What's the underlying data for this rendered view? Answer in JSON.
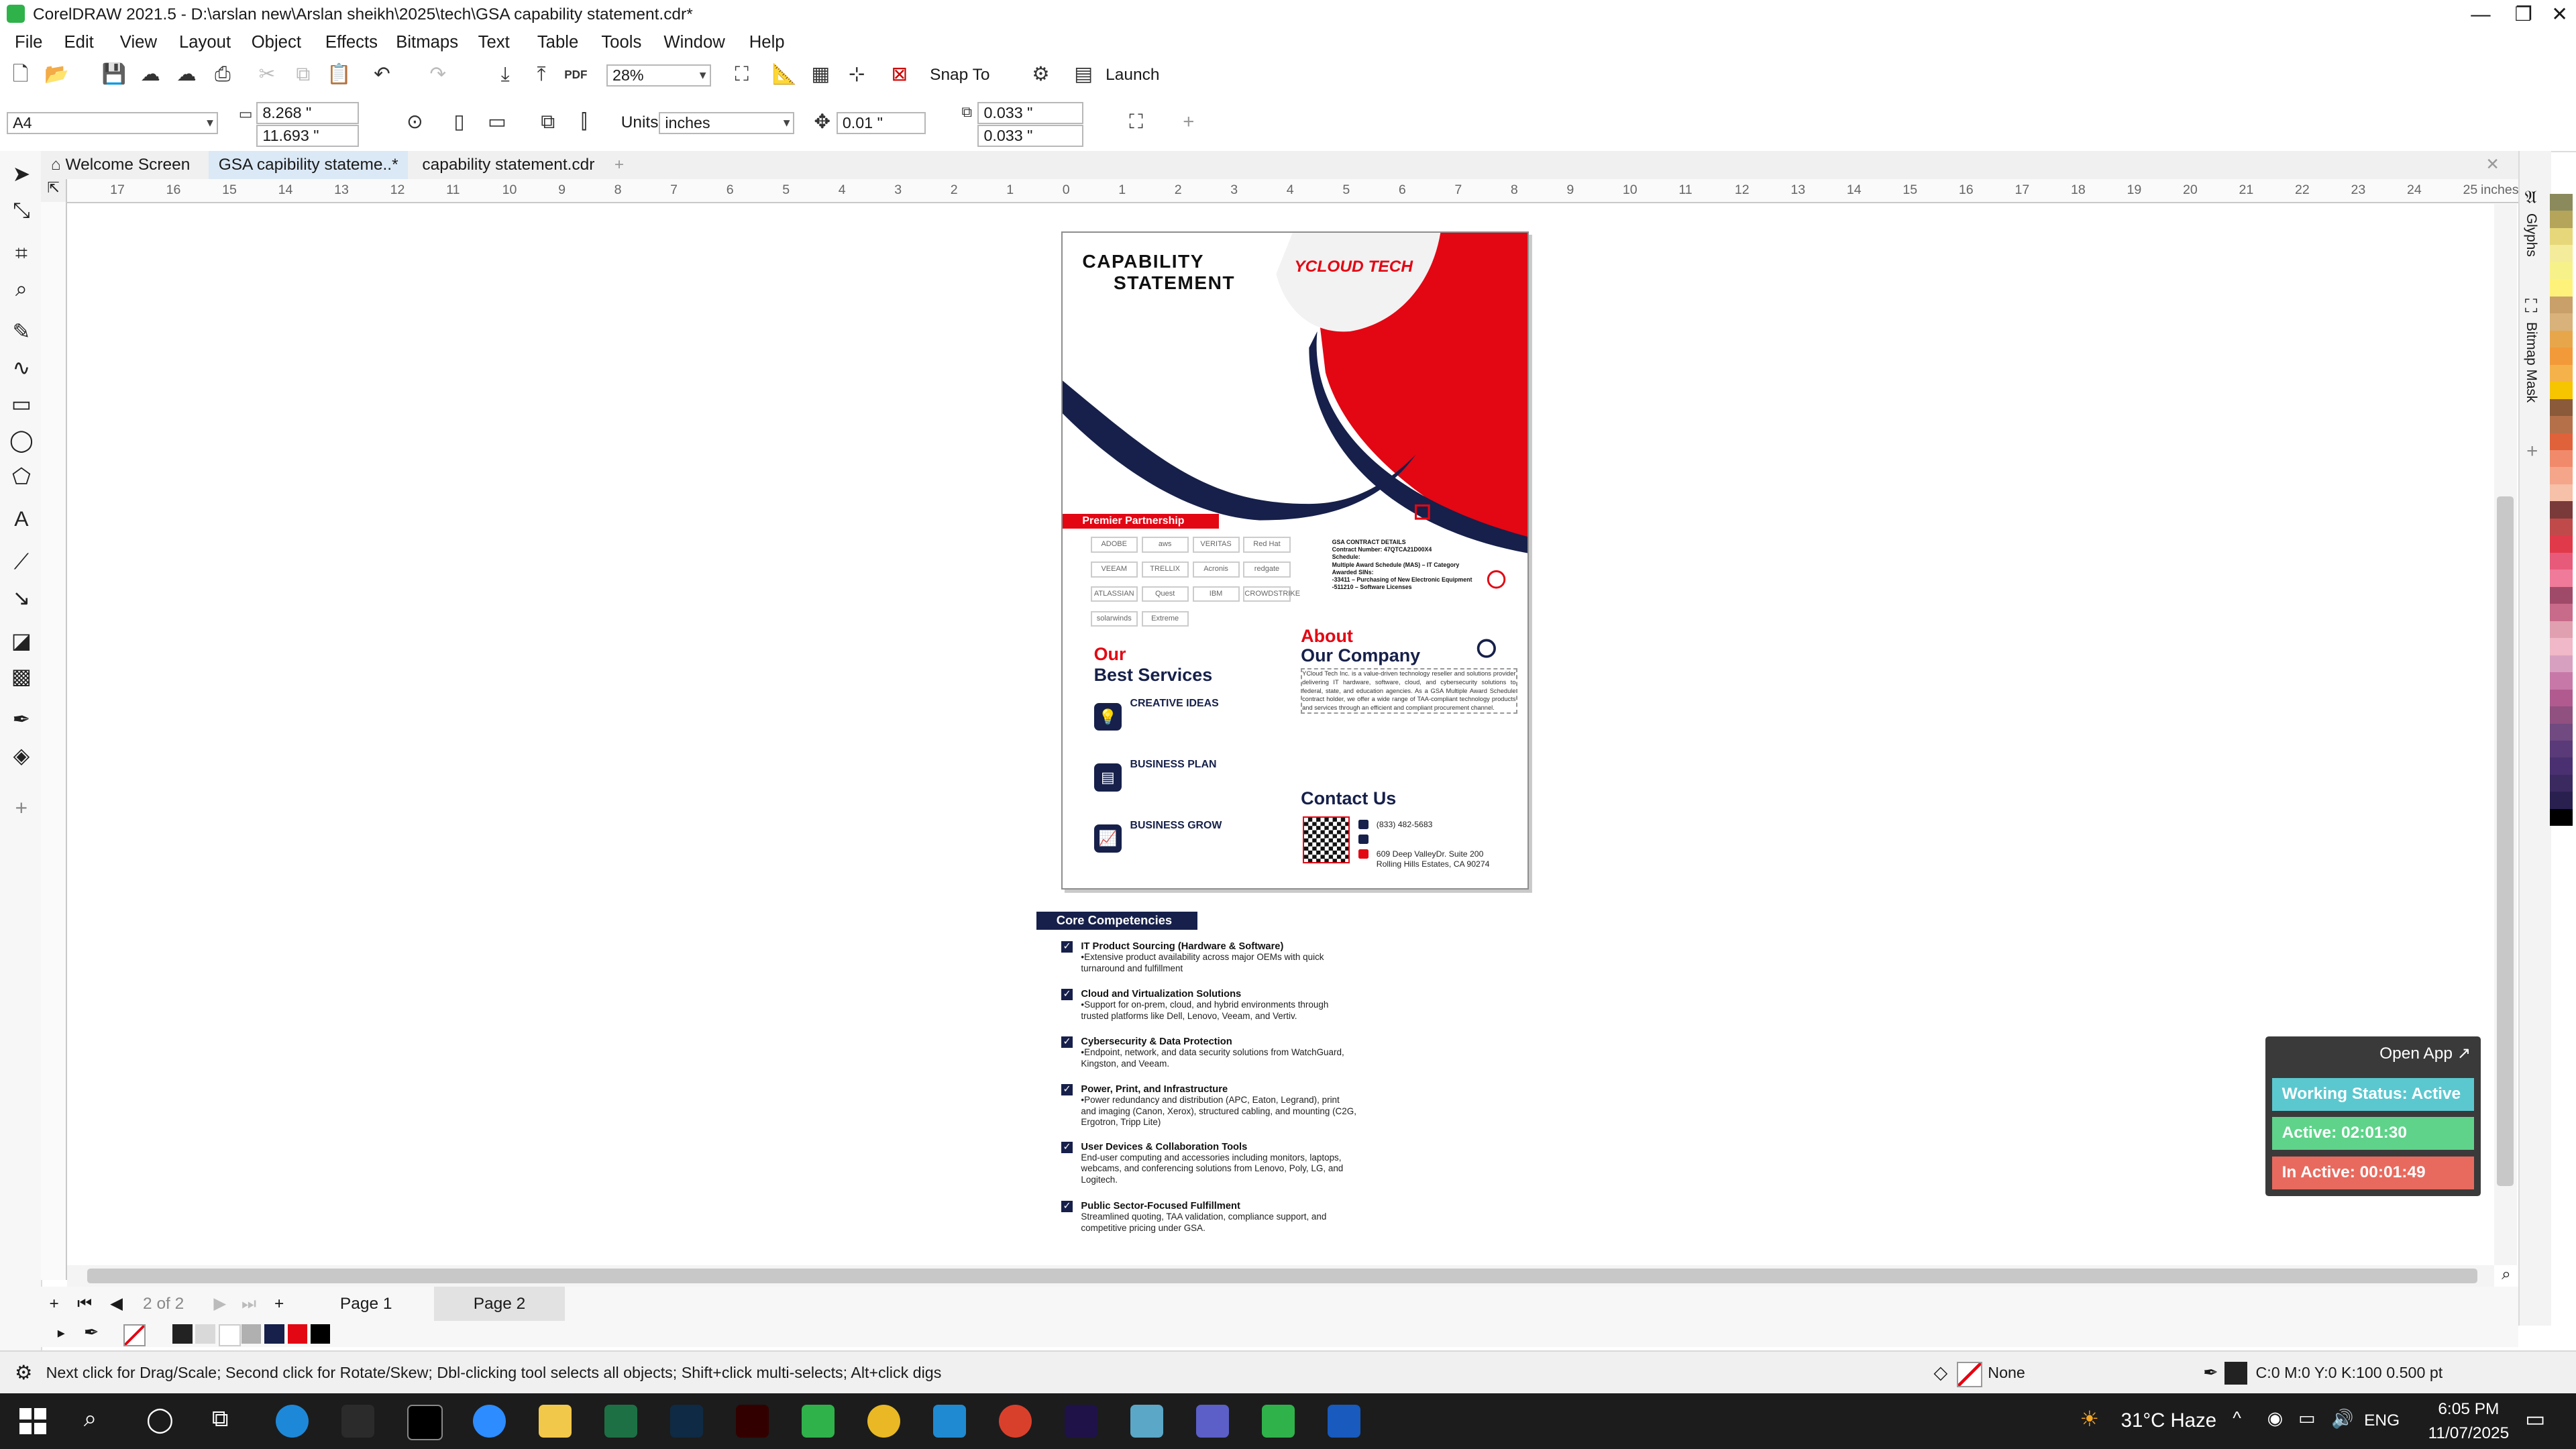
{
  "window": {
    "title": "CorelDRAW 2021.5 - D:\\arslan new\\Arslan sheikh\\2025\\tech\\GSA  capability statement.cdr*",
    "controls": [
      "minimize-icon",
      "restore-icon",
      "close-icon"
    ]
  },
  "menu": [
    "File",
    "Edit",
    "View",
    "Layout",
    "Object",
    "Effects",
    "Bitmaps",
    "Text",
    "Table",
    "Tools",
    "Window",
    "Help"
  ],
  "toolbar": {
    "zoom": "28%",
    "snap_to": "Snap To",
    "launch": "Launch",
    "pdf_label": "PDF"
  },
  "property_bar": {
    "page_size": "A4",
    "width": "8.268 \"",
    "height": "11.693 \"",
    "units_label": "Units:",
    "units": "inches",
    "nudge": "0.01 \"",
    "dup_x": "0.033 \"",
    "dup_y": "0.033 \""
  },
  "tabs": [
    {
      "label": "Welcome Screen",
      "active": false
    },
    {
      "label": "GSA  capibility stateme..*",
      "active": true
    },
    {
      "label": "capability statement.cdr",
      "active": false
    }
  ],
  "ruler": {
    "h_ticks": [
      "17",
      "16",
      "15",
      "14",
      "13",
      "12",
      "11",
      "10",
      "9",
      "8",
      "7",
      "6",
      "5",
      "4",
      "3",
      "2",
      "1",
      "0",
      "1",
      "2",
      "3",
      "4",
      "5",
      "6",
      "7",
      "8",
      "9",
      "10",
      "11",
      "12",
      "13",
      "14",
      "15",
      "16",
      "17",
      "18",
      "19",
      "20",
      "21",
      "22",
      "23",
      "24",
      "25"
    ],
    "units": "inches"
  },
  "document": {
    "title_line1": "CAPABILITY",
    "title_line2": "STATEMENT",
    "brand": "YCLOUD TECH",
    "premier": "Premier Partnership",
    "partner_logos": [
      "ADOBE",
      "aws",
      "VERITAS",
      "Red Hat",
      "VEEAM",
      "TRELLIX",
      "Acronis",
      "redgate",
      "ATLASSIAN",
      "Quest",
      "IBM",
      "CROWDSTRIKE",
      "solarwinds",
      "Extreme"
    ],
    "gsa_heading": "GSA CONTRACT DETAILS",
    "gsa_lines": [
      "Contract Number: 47QTCA21D00X4",
      "Schedule:",
      "Multiple Award Schedule (MAS) – IT Category",
      "Awarded SINs:",
      "-33411 – Purchasing of New Electronic Equipment",
      "-511210 – Software Licenses"
    ],
    "services_title1": "Our",
    "services_title2": "Best Services",
    "services": [
      "CREATIVE IDEAS",
      "BUSINESS PLAN",
      "BUSINESS GROW"
    ],
    "about_title1": "About",
    "about_title2": "Our Company",
    "about_text": "YCloud Tech Inc. is a value-driven technology reseller and solutions provider delivering IT hardware, software, cloud, and cybersecurity solutions to federal, state, and education agencies. As a GSA Multiple Award Schedule contract holder, we offer a wide range of TAA-compliant technology products and services through an efficient and compliant procurement channel.",
    "contact_title": "Contact Us",
    "phone": "(833) 482-5683",
    "address1": "609 Deep ValleyDr. Suite 200",
    "address2": "Rolling Hills Estates, CA 90274"
  },
  "core": {
    "heading": "Core Competencies",
    "items": [
      {
        "title": "IT Product Sourcing (Hardware & Software)",
        "desc": "•Extensive product availability across major OEMs with quick turnaround and fulfillment"
      },
      {
        "title": "Cloud and Virtualization Solutions",
        "desc": "•Support for on-prem, cloud, and hybrid environments through trusted platforms like Dell, Lenovo, Veeam, and Vertiv."
      },
      {
        "title": "Cybersecurity & Data Protection",
        "desc": "•Endpoint, network, and data security solutions from WatchGuard, Kingston, and Veeam."
      },
      {
        "title": "Power, Print, and Infrastructure",
        "desc": "•Power redundancy and distribution (APC, Eaton, Legrand), print and imaging (Canon, Xerox), structured cabling, and mounting (C2G, Ergotron, Tripp Lite)"
      },
      {
        "title": "User Devices & Collaboration Tools",
        "desc": "End-user computing and accessories including monitors, laptops, webcams, and conferencing solutions from Lenovo, Poly, LG, and Logitech."
      },
      {
        "title": "Public Sector-Focused Fulfillment",
        "desc": "Streamlined quoting, TAA validation, compliance support, and competitive pricing under GSA."
      }
    ]
  },
  "widget": {
    "open_app": "Open App ↗",
    "working": "Working Status: Active",
    "active": "Active: 02:01:30",
    "inactive": "In Active: 00:01:49"
  },
  "dockers": [
    "Glyphs",
    "Bitmap Mask"
  ],
  "pages": {
    "counter": "2 of 2",
    "page1": "Page 1",
    "page2": "Page 2"
  },
  "status": {
    "hint": "Next click for Drag/Scale; Second click for Rotate/Skew; Dbl-clicking tool selects all objects; Shift+click multi-selects; Alt+click digs",
    "fill": "None",
    "outline": "C:0 M:0 Y:0 K:100  0.500 pt"
  },
  "taskbar": {
    "weather": "31°C  Haze",
    "lang": "ENG",
    "time": "6:05 PM",
    "date": "11/07/2025"
  },
  "colors": {
    "accent_red": "#e30613",
    "navy": "#16204a",
    "tab_underline": "#3d8fd6",
    "widget_teal": "#5bc8d0",
    "widget_green": "#5fd38a",
    "widget_red": "#e86a5e"
  }
}
